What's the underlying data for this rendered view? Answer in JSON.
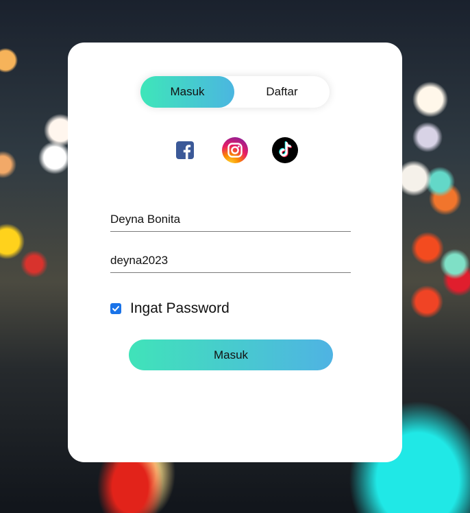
{
  "tabs": {
    "login_label": "Masuk",
    "register_label": "Daftar",
    "active": "login"
  },
  "social": [
    {
      "name": "facebook",
      "icon": "facebook-icon",
      "color": "#3b5998"
    },
    {
      "name": "instagram",
      "icon": "instagram-icon",
      "color": "#d6249f"
    },
    {
      "name": "tiktok",
      "icon": "tiktok-icon",
      "color": "#000000"
    }
  ],
  "form": {
    "username_value": "Deyna Bonita",
    "password_value": "deyna2023",
    "remember_label": "Ingat Password",
    "remember_checked": true,
    "submit_label": "Masuk"
  },
  "colors": {
    "gradient_start": "#3ee6b9",
    "gradient_end": "#4bb6e0",
    "checkbox": "#1a73e8"
  }
}
